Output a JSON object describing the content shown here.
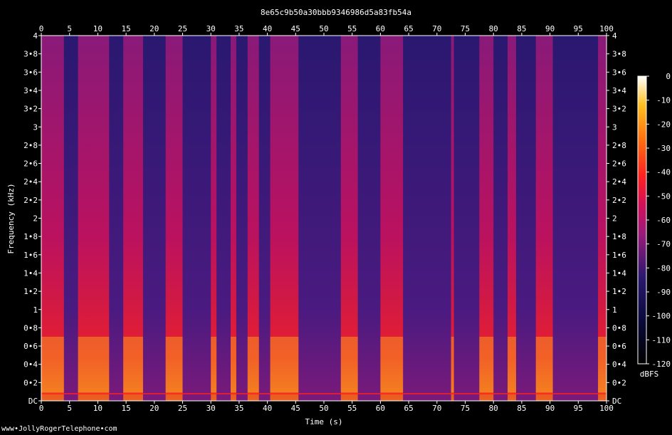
{
  "title": "8e65c9b50a30bbb9346986d5a83fb54a",
  "footer": "www•JollyRogerTelephone•com",
  "colors": {
    "background": "#000000",
    "axis": "#ffffff",
    "colormap": [
      "#000000",
      "#0a0a3a",
      "#2a1870",
      "#5a1a8a",
      "#9a1a7a",
      "#d0105a",
      "#ff2020",
      "#ff7010",
      "#ffc020",
      "#ffff80",
      "#ffffff"
    ]
  },
  "chart_data": {
    "type": "heatmap",
    "title": "8e65c9b50a30bbb9346986d5a83fb54a",
    "xlabel": "Time (s)",
    "ylabel": "Frequency (kHz)",
    "xlim": [
      0,
      100
    ],
    "ylim": [
      0,
      4
    ],
    "x_ticks": [
      "0",
      "5",
      "10",
      "15",
      "20",
      "25",
      "30",
      "35",
      "40",
      "45",
      "50",
      "55",
      "60",
      "65",
      "70",
      "75",
      "80",
      "85",
      "90",
      "95",
      "100"
    ],
    "y_ticks": [
      "DC",
      "0•2",
      "0•4",
      "0•6",
      "0•8",
      "1",
      "1•2",
      "1•4",
      "1•6",
      "1•8",
      "2",
      "2•2",
      "2•4",
      "2•6",
      "2•8",
      "3",
      "3•2",
      "3•4",
      "3•6",
      "3•8",
      "4"
    ],
    "colorbar": {
      "label": "dBFS",
      "range": [
        -120,
        0
      ],
      "ticks": [
        "0",
        "-10",
        "-20",
        "-30",
        "-40",
        "-50",
        "-60",
        "-70",
        "-80",
        "-90",
        "-100",
        "-110",
        "-120"
      ]
    },
    "speech_segments_s": [
      [
        0,
        4
      ],
      [
        6.5,
        12
      ],
      [
        14.5,
        18
      ],
      [
        22,
        25
      ],
      [
        30,
        31
      ],
      [
        33.5,
        34.5
      ],
      [
        36.5,
        38.5
      ],
      [
        40.5,
        45.5
      ],
      [
        53,
        56
      ],
      [
        60,
        64
      ],
      [
        72.5,
        73
      ],
      [
        77.5,
        80
      ],
      [
        82.5,
        84
      ],
      [
        87.5,
        90.5
      ],
      [
        98.5,
        100
      ]
    ]
  }
}
